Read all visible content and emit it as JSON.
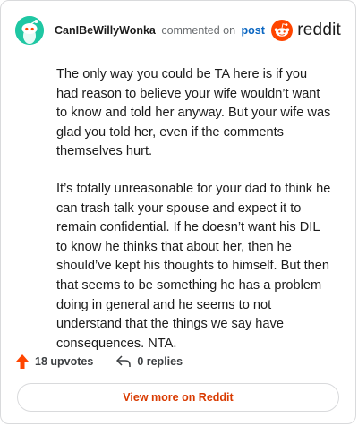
{
  "header": {
    "username": "CanIBeWillyWonka",
    "verb": "commented on",
    "post_link": "post",
    "avatar_icon": "snoo-avatar-icon",
    "brand_icon": "reddit-logo-icon",
    "brand_word": "reddit",
    "avatar_color": "#1fc7a3",
    "brand_color": "#ff4500"
  },
  "comment": {
    "paragraphs": [
      "The only way you could be TA here is if you had reason to believe your wife wouldn’t want to know and told her anyway. But your wife was glad you told her, even if the comments themselves hurt.",
      "It’s totally unreasonable for your dad to think he can trash talk your spouse and expect it to remain confidential. If he doesn’t want his DIL to know he thinks that about her, then he should’ve kept his thoughts to himself. But then that seems to be something he has a problem doing in general and he seems to not understand that the things we say have consequences. NTA."
    ]
  },
  "actions": {
    "upvotes": "18 upvotes",
    "upvote_icon": "upvote-arrow-icon",
    "replies": "0 replies",
    "reply_icon": "reply-arrow-icon"
  },
  "footer": {
    "view_more": "View more on Reddit",
    "accent": "#d93a00"
  }
}
